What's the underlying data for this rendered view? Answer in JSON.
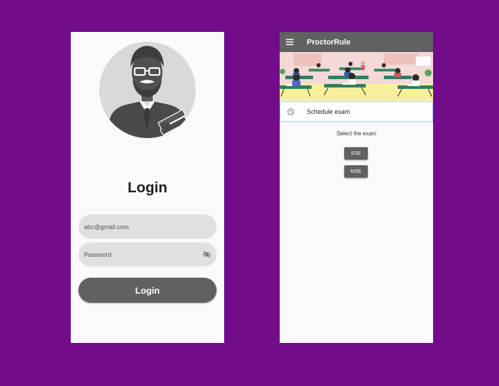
{
  "login_screen": {
    "title": "Login",
    "email_placeholder": "abc@gmail.com",
    "password_placeholder": "Password",
    "button_label": "Login",
    "avatar_icon": "teacher-avatar-icon",
    "visibility_icon": "eye-off-icon"
  },
  "app_screen": {
    "appbar": {
      "title": "ProctorRule",
      "menu_icon": "menu-icon"
    },
    "drawer_item": {
      "label": "Schedule exam",
      "icon": "clock-icon"
    },
    "prompt": "Select the exam",
    "exam_buttons": [
      "ESE",
      "MSE"
    ]
  },
  "colors": {
    "background": "#730c8b",
    "primary": "#616161",
    "input_fill": "#e0e0e0",
    "surface": "#fafafa",
    "selected_border": "#9ad0f0"
  }
}
